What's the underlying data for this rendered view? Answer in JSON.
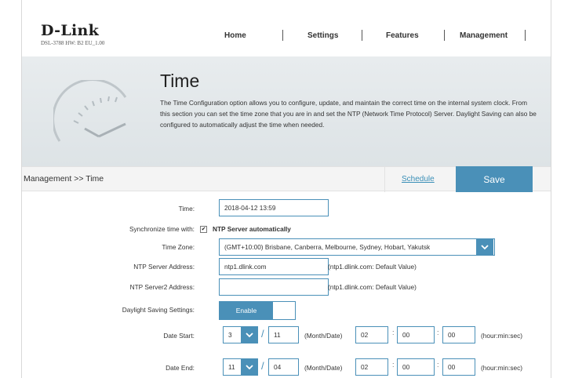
{
  "header": {
    "logo": "D-Link",
    "model": "DSL-3788  HW: B2  EU_1.00",
    "nav": [
      "Home",
      "Settings",
      "Features",
      "Management"
    ]
  },
  "hero": {
    "title": "Time",
    "description": "The Time Configuration option allows you to configure, update, and maintain the correct time on the internal system clock. From this section you can set the time zone that you are in and set the NTP (Network Time Protocol) Server. Daylight Saving can also be configured to automatically adjust the time when needed."
  },
  "breadcrumb": "Management >> Time",
  "schedule_link": "Schedule",
  "save_label": "Save",
  "form": {
    "time_label": "Time:",
    "time_value": "2018-04-12 13:59",
    "sync_label": "Synchronize time with:",
    "sync_checked": true,
    "sync_option": "NTP Server automatically",
    "tz_label": "Time Zone:",
    "tz_value": "(GMT+10:00) Brisbane, Canberra, Melbourne, Sydney, Hobart, Yakutsk",
    "ntp1_label": "NTP Server Address:",
    "ntp1_value": "ntp1.dlink.com",
    "ntp1_note": "(ntp1.dlink.com: Default Value)",
    "ntp2_label": "NTP Server2 Address:",
    "ntp2_value": "",
    "ntp2_note": "(ntp1.dlink.com: Default Value)",
    "dst_label": "Daylight Saving Settings:",
    "dst_value": "Enable",
    "start_label": "Date Start:",
    "start_month": "3",
    "start_date": "11",
    "end_label": "Date End:",
    "end_month": "11",
    "end_date": "04",
    "month_date_note": "(Month/Date)",
    "hour": "02",
    "min": "00",
    "sec": "00",
    "hms_note": "(hour:min:sec)"
  },
  "colors": {
    "accent": "#4a90b8",
    "link": "#3a8fb7"
  }
}
